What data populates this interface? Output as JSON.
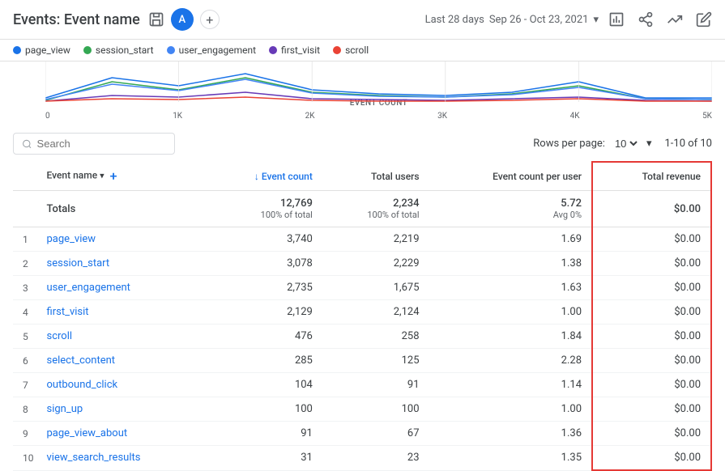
{
  "header": {
    "title": "Events: Event name",
    "avatar_label": "A",
    "date_range_label": "Last 28 days",
    "date_range": "Sep 26 - Oct 23, 2021",
    "chevron": "▾"
  },
  "legend": {
    "items": [
      {
        "label": "page_view",
        "color": "#1a73e8"
      },
      {
        "label": "session_start",
        "color": "#34a853"
      },
      {
        "label": "user_engagement",
        "color": "#4285f4"
      },
      {
        "label": "first_visit",
        "color": "#673ab7"
      },
      {
        "label": "scroll",
        "color": "#ea4335"
      }
    ]
  },
  "chart": {
    "axis_labels": [
      "0",
      "1K",
      "2K",
      "3K",
      "4K",
      "5K"
    ],
    "event_count_label": "EVENT COUNT"
  },
  "search": {
    "placeholder": "Search"
  },
  "table": {
    "rows_per_page_label": "Rows per page:",
    "rows_per_page_value": "10",
    "page_info": "1-10 of 10",
    "columns": [
      {
        "id": "row_num",
        "label": ""
      },
      {
        "id": "event_name",
        "label": "Event name ▾"
      },
      {
        "id": "event_count",
        "label": "↓ Event count"
      },
      {
        "id": "total_users",
        "label": "Total users"
      },
      {
        "id": "event_count_per_user",
        "label": "Event count per user"
      },
      {
        "id": "total_revenue",
        "label": "Total revenue"
      }
    ],
    "totals": {
      "event_count": "12,769",
      "event_count_sub": "100% of total",
      "total_users": "2,234",
      "total_users_sub": "100% of total",
      "event_count_per_user": "5.72",
      "event_count_per_user_sub": "Avg 0%",
      "total_revenue": "$0.00",
      "label": "Totals"
    },
    "rows": [
      {
        "num": "1",
        "event": "page_view",
        "event_count": "3,740",
        "total_users": "2,219",
        "ecpu": "1.69",
        "revenue": "$0.00"
      },
      {
        "num": "2",
        "event": "session_start",
        "event_count": "3,078",
        "total_users": "2,229",
        "ecpu": "1.38",
        "revenue": "$0.00"
      },
      {
        "num": "3",
        "event": "user_engagement",
        "event_count": "2,735",
        "total_users": "1,675",
        "ecpu": "1.63",
        "revenue": "$0.00"
      },
      {
        "num": "4",
        "event": "first_visit",
        "event_count": "2,129",
        "total_users": "2,124",
        "ecpu": "1.00",
        "revenue": "$0.00"
      },
      {
        "num": "5",
        "event": "scroll",
        "event_count": "476",
        "total_users": "258",
        "ecpu": "1.84",
        "revenue": "$0.00"
      },
      {
        "num": "6",
        "event": "select_content",
        "event_count": "285",
        "total_users": "125",
        "ecpu": "2.28",
        "revenue": "$0.00"
      },
      {
        "num": "7",
        "event": "outbound_click",
        "event_count": "104",
        "total_users": "91",
        "ecpu": "1.14",
        "revenue": "$0.00"
      },
      {
        "num": "8",
        "event": "sign_up",
        "event_count": "100",
        "total_users": "100",
        "ecpu": "1.00",
        "revenue": "$0.00"
      },
      {
        "num": "9",
        "event": "page_view_about",
        "event_count": "91",
        "total_users": "67",
        "ecpu": "1.36",
        "revenue": "$0.00"
      },
      {
        "num": "10",
        "event": "view_search_results",
        "event_count": "31",
        "total_users": "23",
        "ecpu": "1.35",
        "revenue": "$0.00"
      }
    ]
  }
}
